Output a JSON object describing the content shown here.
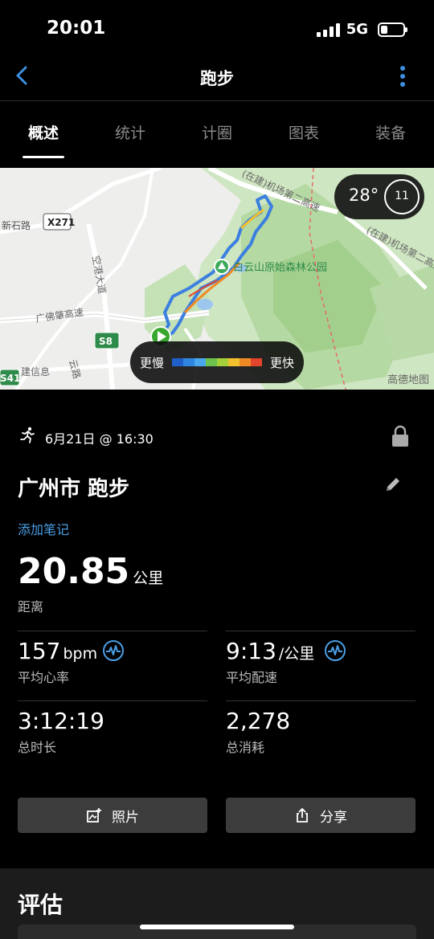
{
  "status": {
    "time": "20:01",
    "network": "5G"
  },
  "nav": {
    "title": "跑步"
  },
  "tabs": [
    "概述",
    "统计",
    "计圈",
    "图表",
    "装备"
  ],
  "map": {
    "labels": {
      "road_xinshi": "新石路",
      "x271": "X271",
      "park": "白云山原始森林公园",
      "airport_top": "(在建)机场第二高速",
      "airport_right": "(在建)机场第二高速",
      "guangfo": "广佛肇高速",
      "konggang": "空港大道",
      "s8": "S8",
      "s41": "S41",
      "jinxinxi": "建信息",
      "yunlu": "云路"
    },
    "weather": {
      "temperature": "28°",
      "wind": "11"
    },
    "legend": {
      "slow": "更慢",
      "fast": "更快",
      "colors": [
        "#1f5fc9",
        "#2f86e0",
        "#4aa8ee",
        "#6cc24a",
        "#a6d03a",
        "#f2c12e",
        "#f08a24",
        "#e2452b"
      ]
    },
    "provider": "高德地图"
  },
  "activity": {
    "date": "6月21日 @ 16:30",
    "title": "广州市 跑步",
    "add_note": "添加笔记",
    "distance_value": "20.85",
    "distance_unit": "公里",
    "distance_label": "距离"
  },
  "stats": {
    "avg_hr_value": "157",
    "avg_hr_unit": "bpm",
    "avg_hr_label": "平均心率",
    "avg_pace_value": "9:13",
    "avg_pace_unit": "/公里",
    "avg_pace_label": "平均配速",
    "duration_value": "3:12:19",
    "duration_label": "总时长",
    "calories_value": "2,278",
    "calories_label": "总消耗"
  },
  "buttons": {
    "photos": "照片",
    "share": "分享"
  },
  "assessment": {
    "title": "评估"
  }
}
